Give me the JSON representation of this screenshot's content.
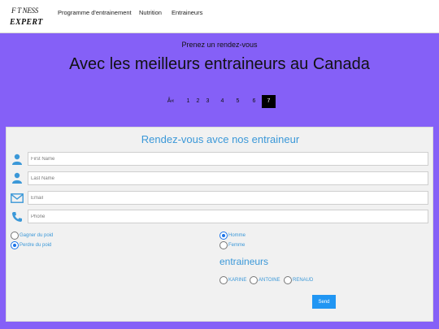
{
  "brand": {
    "logo_top": "F  T NESS",
    "logo_t": "i",
    "logo_bottom": "EXPERT"
  },
  "nav": {
    "items": [
      {
        "label": "Programme d'entrainement"
      },
      {
        "label": "Nutrition"
      },
      {
        "label": "Entraineurs"
      }
    ]
  },
  "hero": {
    "subtitle": "Prenez un rendez-vous",
    "title": "Avec les meilleurs entraineurs au Canada"
  },
  "pagination": {
    "items": [
      "Â«",
      "1",
      "2",
      "3",
      "4",
      "5",
      "6",
      "7"
    ],
    "active": "7"
  },
  "form": {
    "title": "Rendez-vous avce nos entraineur",
    "fields": {
      "first_name": {
        "placeholder": "First Name",
        "value": ""
      },
      "last_name": {
        "placeholder": "Last Name",
        "value": ""
      },
      "email": {
        "placeholder": "Email",
        "value": ""
      },
      "phone": {
        "placeholder": "Phone",
        "value": ""
      }
    },
    "goals": [
      {
        "label": "Gagner du poid",
        "checked": false
      },
      {
        "label": "Perdre du poid",
        "checked": true
      }
    ],
    "genders": [
      {
        "label": "Homme",
        "checked": true
      },
      {
        "label": "Femme",
        "checked": false
      }
    ],
    "trainers_title": "entraineurs",
    "trainers": [
      {
        "label": "KARINE",
        "checked": false
      },
      {
        "label": "ANTOINE",
        "checked": false
      },
      {
        "label": "RENAUD",
        "checked": false
      }
    ],
    "send_label": "Send"
  },
  "colors": {
    "background": "#8560f7",
    "accent": "#3b98d8",
    "button": "#2196f3",
    "pager_active": "#000000"
  }
}
